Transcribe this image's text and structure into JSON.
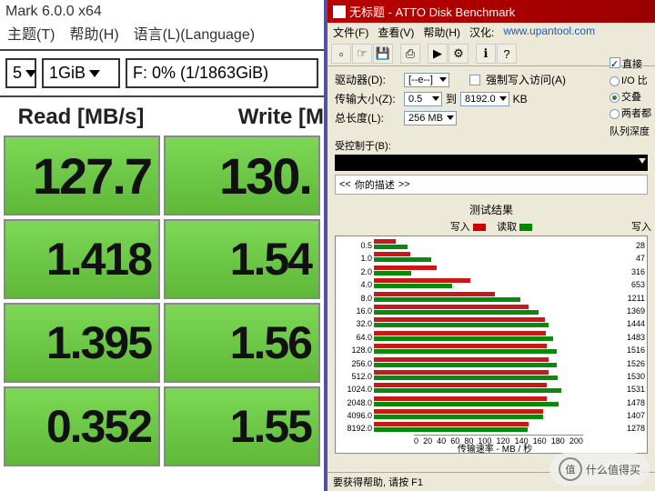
{
  "left": {
    "title": "Mark 6.0.0 x64",
    "menu": {
      "theme": "主题(T)",
      "help": "帮助(H)",
      "lang": "语言(L)(Language)"
    },
    "dd1": "5",
    "dd2": "1GiB",
    "dd3": "F: 0% (1/1863GiB)",
    "header_read": "Read [MB/s]",
    "header_write": "Write [M",
    "rows": [
      {
        "read": "127.7",
        "write": "130."
      },
      {
        "read": "1.418",
        "write": "1.54"
      },
      {
        "read": "1.395",
        "write": "1.56"
      },
      {
        "read": "0.352",
        "write": "1.55"
      }
    ]
  },
  "right": {
    "titlebar": "无标题 - ATTO Disk Benchmark",
    "menus": {
      "file": "文件(F)",
      "view": "查看(V)",
      "help": "帮助(H)",
      "cn": "汉化:",
      "url": "www.upantool.com"
    },
    "form": {
      "drive_label": "驱动器(D):",
      "drive_val": "[--e--]",
      "force_label": "强制写入访问(A)",
      "direct_label": "直接",
      "size_label": "传输大小(Z):",
      "size_from": "0.5",
      "size_to": "8192.0",
      "mid": "到",
      "kb": "KB",
      "io_label": "I/O 比",
      "overlap_label": "交叠",
      "both_label": "两者都",
      "len_label": "总长度(L):",
      "len_val": "256 MB",
      "depth_label": "队列深度"
    },
    "controlled_label": "受控制于(B):",
    "desc_prefix": "<<",
    "desc_text": "你的描述",
    "desc_suffix": ">>",
    "result_title": "测试结果",
    "legend": {
      "write": "写入",
      "read": "读取",
      "right_write": "写入"
    },
    "xlabel": "传输速率 - MB / 秒",
    "status": "要获得帮助, 请按 F1",
    "xticks": [
      "0",
      "20",
      "40",
      "60",
      "80",
      "100",
      "120",
      "140",
      "160",
      "180",
      "200"
    ]
  },
  "chart_data": {
    "type": "bar",
    "title": "测试结果",
    "xlabel": "传输速率 - MB / 秒",
    "ylabel": "",
    "xlim": [
      0,
      200
    ],
    "categories": [
      "0.5",
      "1.0",
      "2.0",
      "4.0",
      "8.0",
      "16.0",
      "32.0",
      "64.0",
      "128.0",
      "256.0",
      "512.0",
      "1024.0",
      "2048.0",
      "4096.0",
      "8192.0"
    ],
    "series": [
      {
        "name": "写入",
        "values": [
          18,
          30,
          52,
          80,
          100,
          128,
          141,
          142,
          143,
          144,
          144,
          143,
          143,
          140,
          128
        ]
      },
      {
        "name": "读取",
        "values": [
          28,
          47,
          31,
          65,
          121,
          136,
          144,
          148,
          151,
          151,
          152,
          155,
          153,
          140,
          127
        ]
      }
    ],
    "right_values": [
      "28",
      "47",
      "316",
      "653",
      "1211",
      "1369",
      "1444",
      "1483",
      "1516",
      "1526",
      "1530",
      "1531",
      "1478",
      "1407",
      "1278"
    ]
  },
  "watermark": {
    "circle": "值",
    "text": "什么值得买"
  }
}
